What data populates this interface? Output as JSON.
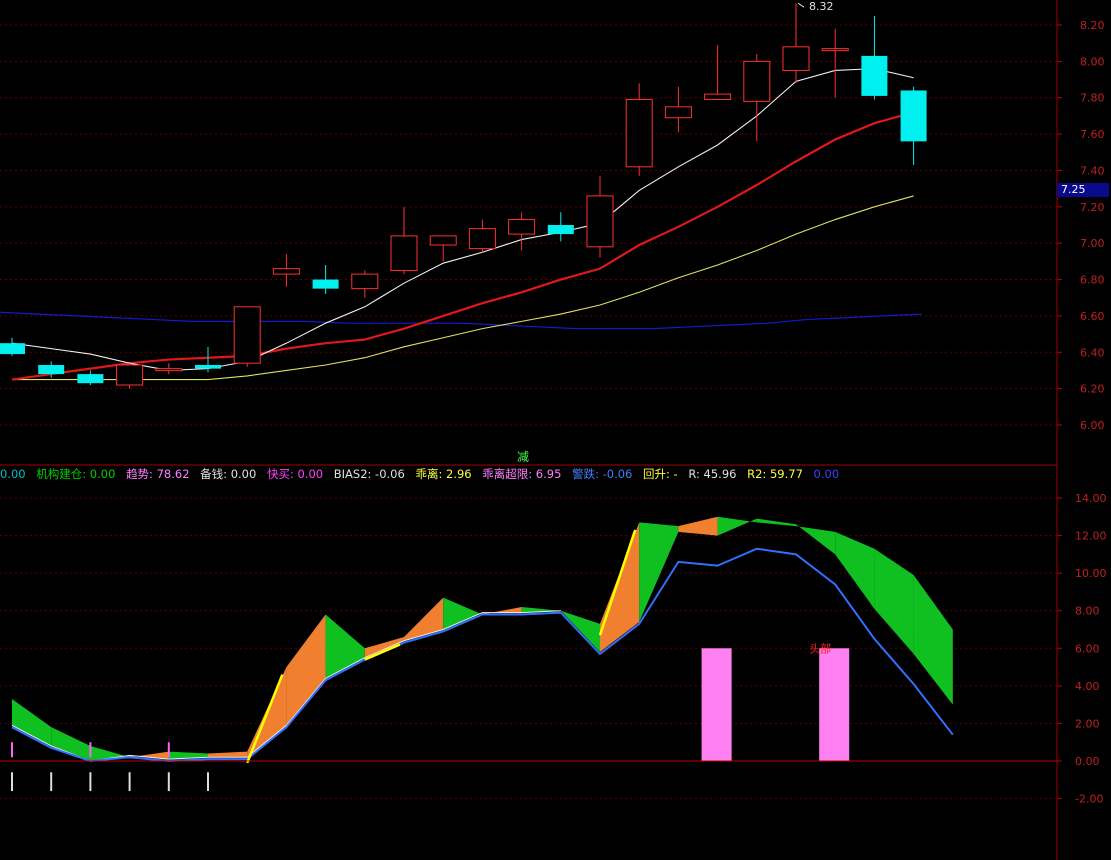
{
  "chart_data": [
    {
      "type": "candlestick",
      "title": "",
      "ylim": [
        5.9,
        8.32
      ],
      "yticks": [
        "8.20",
        "8.00",
        "7.80",
        "7.60",
        "7.40",
        "7.20",
        "7.00",
        "6.80",
        "6.60",
        "6.40",
        "6.20",
        "6.00"
      ],
      "high_label": "8.32",
      "last_price": "7.25",
      "candles": [
        {
          "o": 6.45,
          "c": 6.39,
          "h": 6.48,
          "l": 6.38
        },
        {
          "o": 6.33,
          "c": 6.28,
          "h": 6.35,
          "l": 6.26
        },
        {
          "o": 6.28,
          "c": 6.23,
          "h": 6.3,
          "l": 6.22
        },
        {
          "o": 6.22,
          "c": 6.33,
          "h": 6.34,
          "l": 6.2
        },
        {
          "o": 6.3,
          "c": 6.31,
          "h": 6.34,
          "l": 6.28
        },
        {
          "o": 6.33,
          "c": 6.31,
          "h": 6.43,
          "l": 6.29
        },
        {
          "o": 6.34,
          "c": 6.65,
          "h": 6.65,
          "l": 6.32
        },
        {
          "o": 6.83,
          "c": 6.86,
          "h": 6.94,
          "l": 6.76
        },
        {
          "o": 6.8,
          "c": 6.75,
          "h": 6.88,
          "l": 6.72
        },
        {
          "o": 6.75,
          "c": 6.83,
          "h": 6.85,
          "l": 6.7
        },
        {
          "o": 6.85,
          "c": 7.04,
          "h": 7.2,
          "l": 6.83
        },
        {
          "o": 6.99,
          "c": 7.04,
          "h": 7.04,
          "l": 6.9
        },
        {
          "o": 6.97,
          "c": 7.08,
          "h": 7.13,
          "l": 6.95
        },
        {
          "o": 7.05,
          "c": 7.13,
          "h": 7.17,
          "l": 6.96
        },
        {
          "o": 7.1,
          "c": 7.05,
          "h": 7.17,
          "l": 7.01
        },
        {
          "o": 6.98,
          "c": 7.26,
          "h": 7.37,
          "l": 6.92
        },
        {
          "o": 7.42,
          "c": 7.79,
          "h": 7.88,
          "l": 7.37
        },
        {
          "o": 7.69,
          "c": 7.75,
          "h": 7.86,
          "l": 7.61
        },
        {
          "o": 7.79,
          "c": 7.82,
          "h": 8.09,
          "l": 7.79
        },
        {
          "o": 7.78,
          "c": 8.0,
          "h": 8.04,
          "l": 7.56
        },
        {
          "o": 7.95,
          "c": 8.08,
          "h": 8.32,
          "l": 7.88
        },
        {
          "o": 8.06,
          "c": 8.07,
          "h": 8.18,
          "l": 7.8
        },
        {
          "o": 8.03,
          "c": 7.81,
          "h": 8.25,
          "l": 7.79
        },
        {
          "o": 7.84,
          "c": 7.56,
          "h": 7.86,
          "l": 7.43
        }
      ],
      "ma_white": [
        6.45,
        6.42,
        6.39,
        6.34,
        6.3,
        6.31,
        6.35,
        6.45,
        6.56,
        6.65,
        6.78,
        6.89,
        6.95,
        7.02,
        7.06,
        7.11,
        7.29,
        7.42,
        7.54,
        7.7,
        7.89,
        7.95,
        7.96,
        7.91
      ],
      "ma_red": [
        6.25,
        6.28,
        6.31,
        6.34,
        6.36,
        6.37,
        6.38,
        6.42,
        6.45,
        6.47,
        6.53,
        6.6,
        6.67,
        6.73,
        6.8,
        6.86,
        6.99,
        7.09,
        7.2,
        7.32,
        7.45,
        7.57,
        7.66,
        7.72
      ],
      "ma_yellow": [
        6.25,
        6.25,
        6.25,
        6.25,
        6.25,
        6.25,
        6.27,
        6.3,
        6.33,
        6.37,
        6.43,
        6.48,
        6.53,
        6.57,
        6.61,
        6.66,
        6.73,
        6.81,
        6.88,
        6.96,
        7.05,
        7.13,
        7.2,
        7.26
      ],
      "ma_blue": [
        6.62,
        6.61,
        6.6,
        6.59,
        6.58,
        6.57,
        6.57,
        6.57,
        6.57,
        6.56,
        6.56,
        6.56,
        6.56,
        6.55,
        6.54,
        6.53,
        6.53,
        6.53,
        6.54,
        6.55,
        6.56,
        6.58,
        6.59,
        6.6,
        6.61
      ]
    },
    {
      "type": "area",
      "ylim": [
        -2.0,
        15.0
      ],
      "yticks": [
        "14.00",
        "12.00",
        "10.00",
        "8.00",
        "6.00",
        "4.00",
        "2.00",
        "0.00",
        "-2.00"
      ],
      "band_top": [
        3.3,
        1.8,
        0.8,
        0.2,
        0.5,
        0.4,
        0.5,
        5.0,
        7.8,
        6.0,
        6.6,
        8.7,
        7.8,
        8.2,
        8.0,
        7.3,
        12.7,
        12.5,
        13.0,
        12.7,
        12.5,
        12.2,
        11.3,
        9.9,
        7.0
      ],
      "band_bottom": [
        1.9,
        0.8,
        0.0,
        0.3,
        0.1,
        0.2,
        0.2,
        1.9,
        4.4,
        5.5,
        6.4,
        7.0,
        7.9,
        7.9,
        8.0,
        5.8,
        7.4,
        12.2,
        12.0,
        12.9,
        12.6,
        11.0,
        8.1,
        5.7,
        3.0
      ],
      "bars": [
        {
          "index": 18,
          "value": 6.0
        },
        {
          "index": 21,
          "value": 6.0
        }
      ],
      "red_label": "头部",
      "marker_text": "减",
      "indicators": [
        {
          "text": "0.00",
          "color": "#00c0c0"
        },
        {
          "text": "机构建仓: 0.00",
          "color": "#00d000"
        },
        {
          "text": "趋势: 78.62",
          "color": "#ff80ff"
        },
        {
          "text": "备钱: 0.00",
          "color": "#e0e0e0"
        },
        {
          "text": "快买: 0.00",
          "color": "#ff40ff"
        },
        {
          "text": "BIAS2: -0.06",
          "color": "#e0e0e0"
        },
        {
          "text": "乖离: 2.96",
          "color": "#ffff40"
        },
        {
          "text": "乖离超限: 6.95",
          "color": "#ff80ff"
        },
        {
          "text": "警跌: -0.06",
          "color": "#4080ff"
        },
        {
          "text": "回升: -",
          "color": "#ffff40"
        },
        {
          "text": "R: 45.96",
          "color": "#e0e0e0"
        },
        {
          "text": "R2: 59.77",
          "color": "#ffff40"
        },
        {
          "text": "0.00",
          "color": "#4040ff"
        }
      ]
    }
  ]
}
